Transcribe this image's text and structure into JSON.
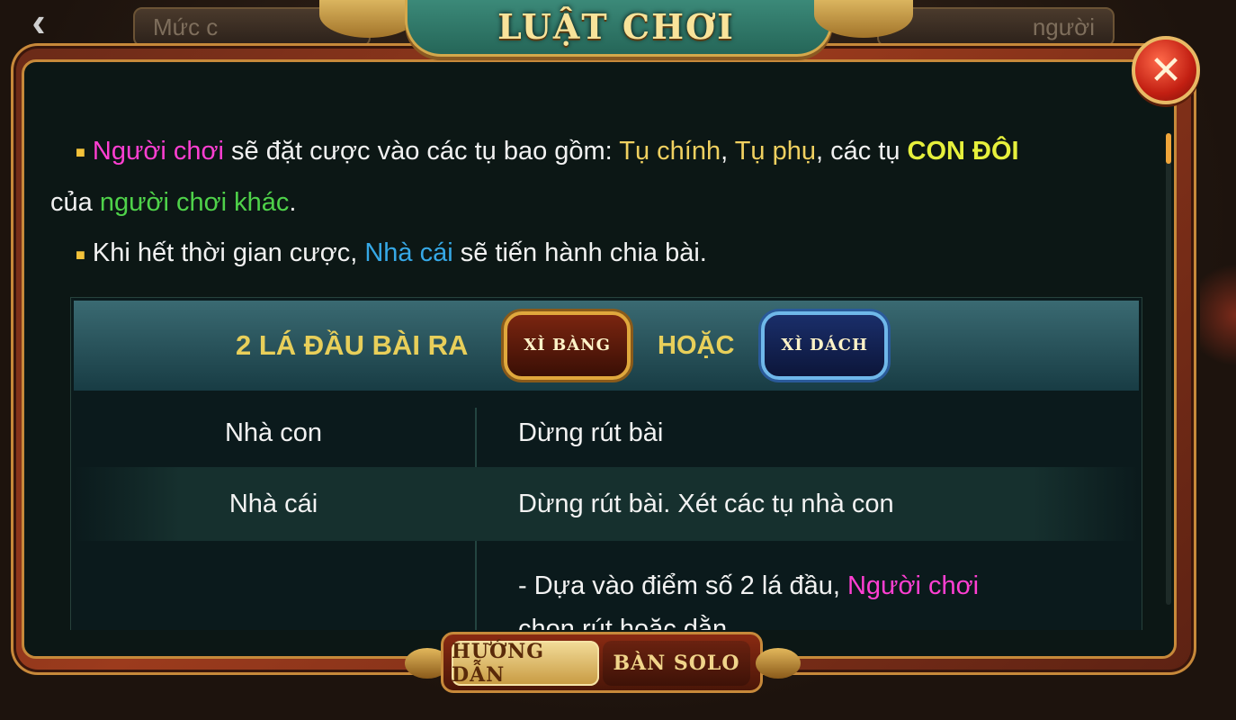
{
  "background": {
    "back_icon": "chevron-left-icon",
    "tab_left_label": "Mức c",
    "tab_right_label": "người"
  },
  "modal": {
    "title": "LUẬT CHƠI",
    "close_icon": "close-x-icon"
  },
  "rules": {
    "para1": {
      "p1": "Người chơi",
      "p2": " sẽ đặt cược vào các tụ bao gồm: ",
      "p3": "Tụ chính",
      "p4": ", ",
      "p5": "Tụ phụ",
      "p6": ", các tụ ",
      "p7": "CON ĐÔI",
      "p8": "của ",
      "p9": "người chơi khác",
      "p10": "."
    },
    "para2": {
      "p1": "Khi hết thời gian cược, ",
      "p2": "Nhà cái",
      "p3": " sẽ tiến hành chia bài."
    }
  },
  "table": {
    "header": {
      "text": "2 LÁ ĐẦU BÀI RA",
      "badge1": "XÌ BÀNG",
      "or_text": "HOẶC",
      "badge2": "XÌ DÁCH"
    },
    "rows": [
      {
        "col1": "Nhà con",
        "col2": "Dừng rút bài"
      },
      {
        "col1": "Nhà cái",
        "col2": "Dừng rút bài. Xét các tụ nhà con"
      }
    ],
    "row3": {
      "p1": "- Dựa vào điểm số 2 lá đầu, ",
      "p2": "Người chơi",
      "p3": "chọn rút hoặc dằn"
    }
  },
  "bottom_tabs": {
    "tab1": "HƯỚNG DẪN",
    "tab2": "BÀN SOLO"
  },
  "colors": {
    "highlight_pink": "#ff3fd2",
    "highlight_yellow": "#f0d060",
    "highlight_lime": "#e6f03c",
    "highlight_green": "#4fd24a",
    "highlight_blue": "#36a8e6",
    "gold": "#e8cf5a"
  }
}
